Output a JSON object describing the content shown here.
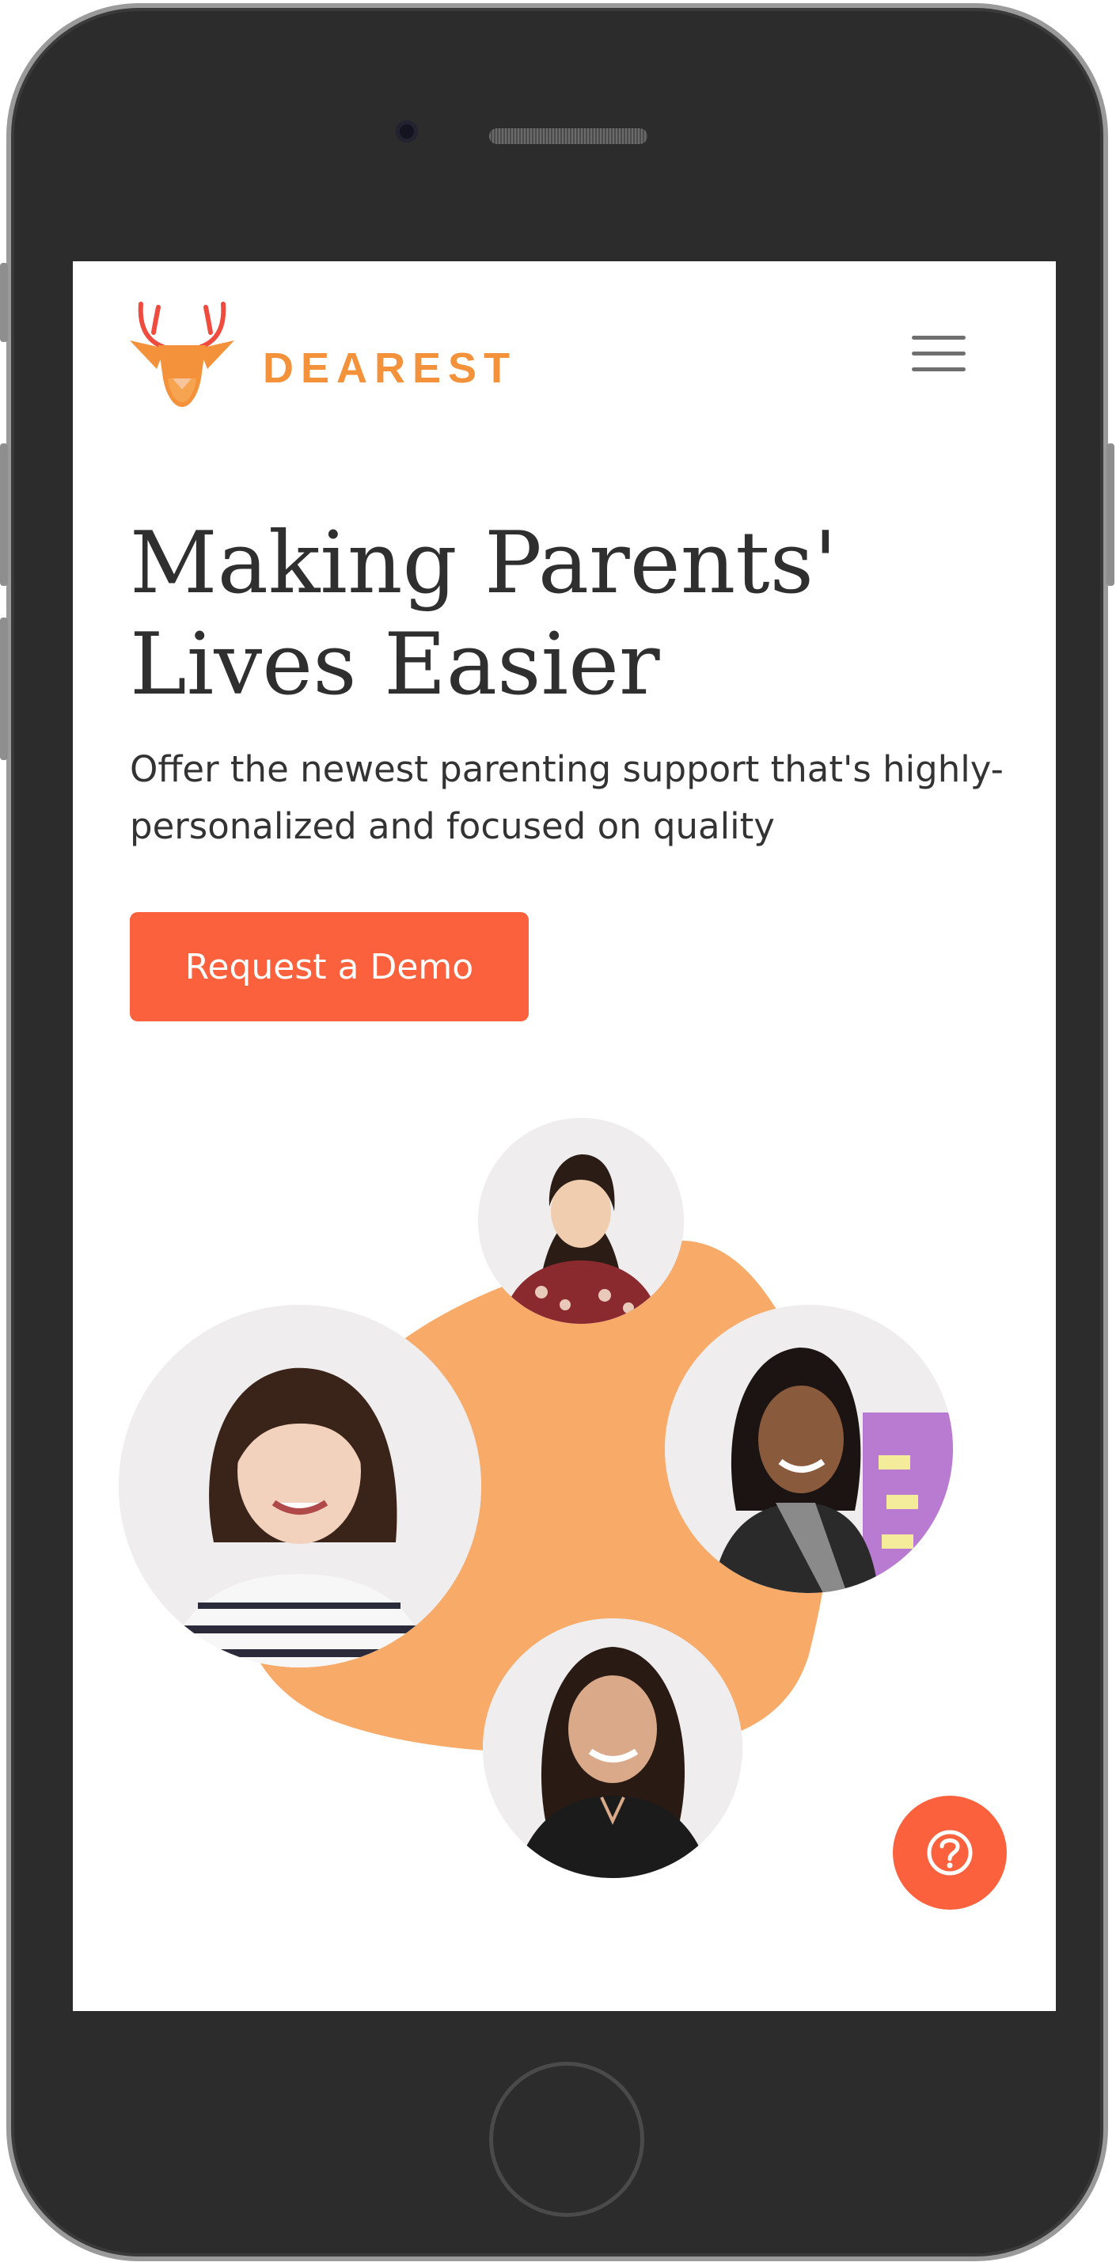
{
  "brand": {
    "name": "DEAREST",
    "colors": {
      "primary": "#fb613d",
      "logo": "#f3923a",
      "blob": "#f8ab69",
      "antler": "#ef4b3f",
      "text": "#2f2f2f"
    }
  },
  "header": {
    "menu_icon": "hamburger-icon"
  },
  "hero": {
    "title": "Making Parents' Lives Easier",
    "subtitle": "Offer the newest parenting support that's highly-personalized and focused on quality",
    "cta_label": "Request a Demo"
  },
  "team_photos": [
    {
      "name": "team-member-1",
      "description_icon": "person-photo"
    },
    {
      "name": "team-member-2",
      "description_icon": "person-photo"
    },
    {
      "name": "team-member-3",
      "description_icon": "person-photo"
    },
    {
      "name": "team-member-4",
      "description_icon": "person-photo"
    }
  ],
  "help": {
    "icon": "question-mark-icon"
  }
}
